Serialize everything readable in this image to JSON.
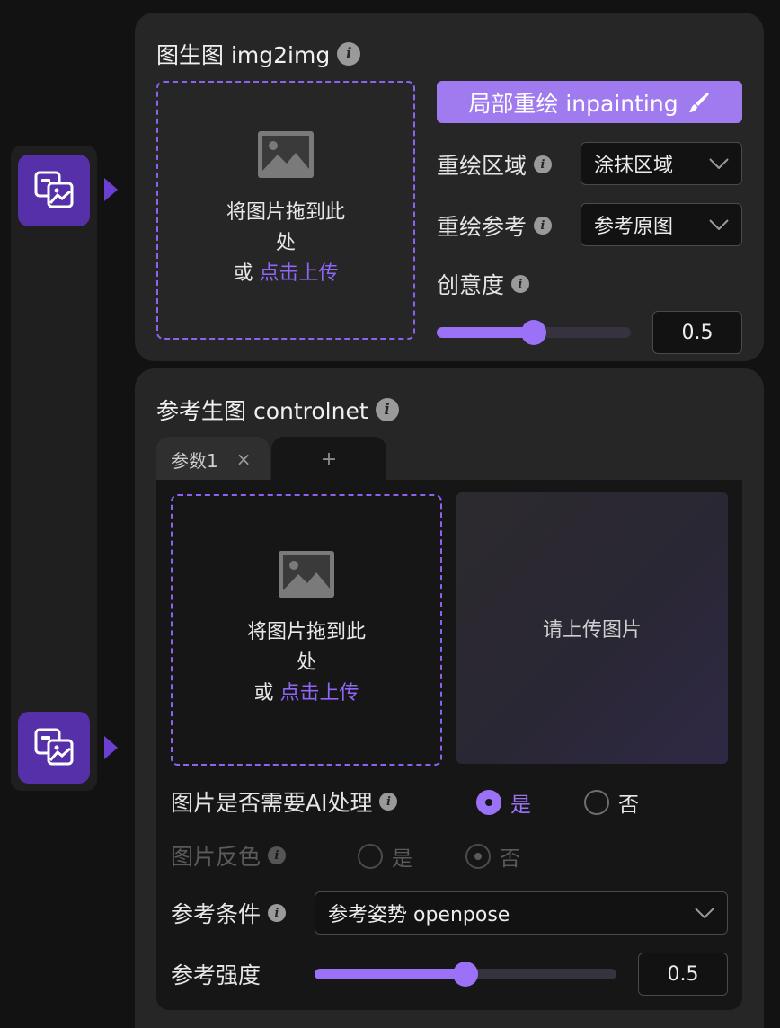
{
  "img2img": {
    "title": "图生图 img2img",
    "dropzone": {
      "line1": "将图片拖到此",
      "line2": "处",
      "or": "或",
      "link": "点击上传"
    },
    "inpaint_button": "局部重绘 inpainting",
    "redraw_area": {
      "label": "重绘区域",
      "value": "涂抹区域"
    },
    "redraw_ref": {
      "label": "重绘参考",
      "value": "参考原图"
    },
    "creativity": {
      "label": "创意度",
      "value": "0.5",
      "fraction": 0.5
    }
  },
  "controlnet": {
    "title": "参考生图 controlnet",
    "tabs": [
      {
        "label": "参数1",
        "close": "×"
      }
    ],
    "add_tab": "+",
    "dropzone": {
      "line1": "将图片拖到此",
      "line2": "处",
      "or": "或",
      "link": "点击上传"
    },
    "preview_text": "请上传图片",
    "ai_process": {
      "label": "图片是否需要AI处理",
      "yes": "是",
      "no": "否",
      "selected": "是"
    },
    "invert": {
      "label": "图片反色",
      "yes": "是",
      "no": "否",
      "selected": "否",
      "disabled": true
    },
    "condition": {
      "label": "参考条件",
      "value": "参考姿势 openpose"
    },
    "strength": {
      "label": "参考强度",
      "value": "0.5",
      "fraction": 0.5
    }
  },
  "colors": {
    "accent": "#9b72f7",
    "rail_button": "#5630a8",
    "inpaint_button": "#a07bf0"
  },
  "icons": [
    "images-stack-icon",
    "image-placeholder-icon",
    "brush-icon",
    "info-icon",
    "chevron-down-icon"
  ]
}
